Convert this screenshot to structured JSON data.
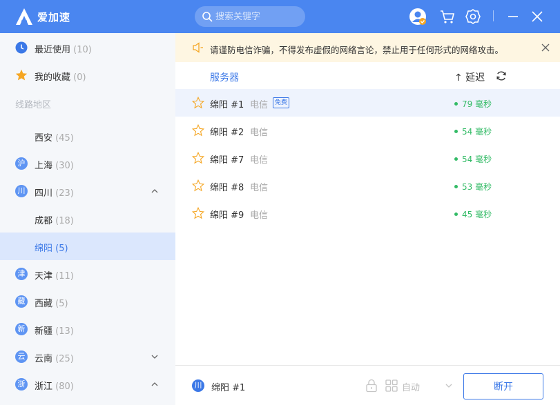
{
  "app": {
    "title": "爱加速",
    "search_placeholder": "搜索关键字"
  },
  "sidebar": {
    "recent": {
      "label": "最近使用",
      "count": "(10)"
    },
    "favorites": {
      "label": "我的收藏",
      "count": "(0)"
    },
    "section_title": "线路地区",
    "regions": [
      {
        "badge": "",
        "label": "西安",
        "count": "(45)"
      },
      {
        "badge": "沪",
        "label": "上海",
        "count": "(30)"
      },
      {
        "badge": "川",
        "label": "四川",
        "count": "(23)"
      },
      {
        "badge": "",
        "label": "成都",
        "count": "(18)"
      },
      {
        "badge": "",
        "label": "绵阳",
        "count": "(5)"
      },
      {
        "badge": "津",
        "label": "天津",
        "count": "(11)"
      },
      {
        "badge": "藏",
        "label": "西藏",
        "count": "(5)"
      },
      {
        "badge": "新",
        "label": "新疆",
        "count": "(13)"
      },
      {
        "badge": "云",
        "label": "云南",
        "count": "(25)"
      },
      {
        "badge": "浙",
        "label": "浙江",
        "count": "(80)"
      }
    ]
  },
  "notice": {
    "text": "请谨防电信诈骗，不得发布虚假的网络言论，禁止用于任何形式的网络攻击。"
  },
  "list_header": {
    "server": "服务器",
    "latency": "↑ 延迟"
  },
  "servers": [
    {
      "name": "绵阳 #1",
      "isp": "电信",
      "free": "免费",
      "latency": "79 毫秒"
    },
    {
      "name": "绵阳 #2",
      "isp": "电信",
      "latency": "54 毫秒"
    },
    {
      "name": "绵阳 #7",
      "isp": "电信",
      "latency": "54 毫秒"
    },
    {
      "name": "绵阳 #8",
      "isp": "电信",
      "latency": "53 毫秒"
    },
    {
      "name": "绵阳 #9",
      "isp": "电信",
      "latency": "45 毫秒"
    }
  ],
  "bottom": {
    "current_badge": "川",
    "current_name": "绵阳 #1",
    "mode": "自动",
    "disconnect": "断开"
  },
  "colors": {
    "brand": "#4a86f0",
    "accent": "#3b78e7",
    "latency_good": "#33bb66",
    "notice_bg": "#fef6e2",
    "star": "#f5a623"
  }
}
